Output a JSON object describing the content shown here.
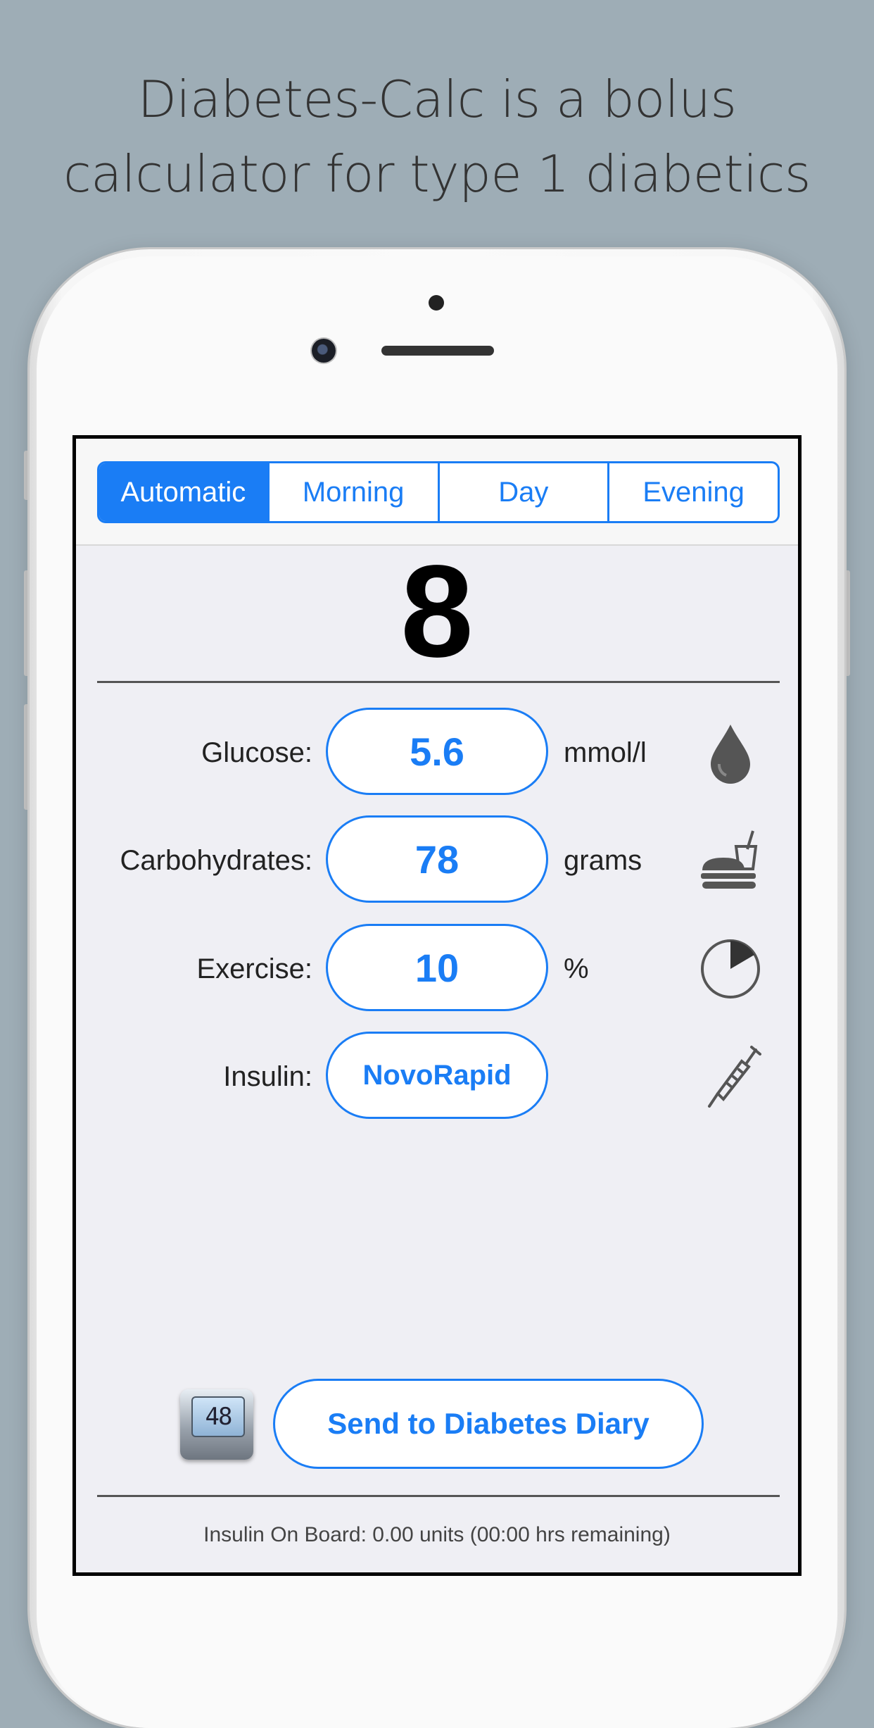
{
  "headline": {
    "line1": "Diabetes-Calc is a bolus",
    "line2": "calculator for type 1 diabetics"
  },
  "tabs": [
    {
      "label": "Automatic",
      "active": true
    },
    {
      "label": "Morning",
      "active": false
    },
    {
      "label": "Day",
      "active": false
    },
    {
      "label": "Evening",
      "active": false
    }
  ],
  "result": "8",
  "rows": {
    "glucose": {
      "label": "Glucose:",
      "value": "5.6",
      "unit": "mmol/l",
      "icon": "drop-icon"
    },
    "carbs": {
      "label": "Carbohydrates:",
      "value": "78",
      "unit": "grams",
      "icon": "food-drink-icon"
    },
    "exercise": {
      "label": "Exercise:",
      "value": "10",
      "unit": "%",
      "icon": "pie-timer-icon"
    },
    "insulin": {
      "label": "Insulin:",
      "value": "NovoRapid",
      "icon": "syringe-icon"
    }
  },
  "calculator_display": "48",
  "diary_button": "Send to Diabetes Diary",
  "insulin_on_board": "Insulin On Board: 0.00 units (00:00 hrs remaining)",
  "colors": {
    "accent": "#1a7df5",
    "background": "#9eadb6",
    "screen": "#efeff4"
  }
}
